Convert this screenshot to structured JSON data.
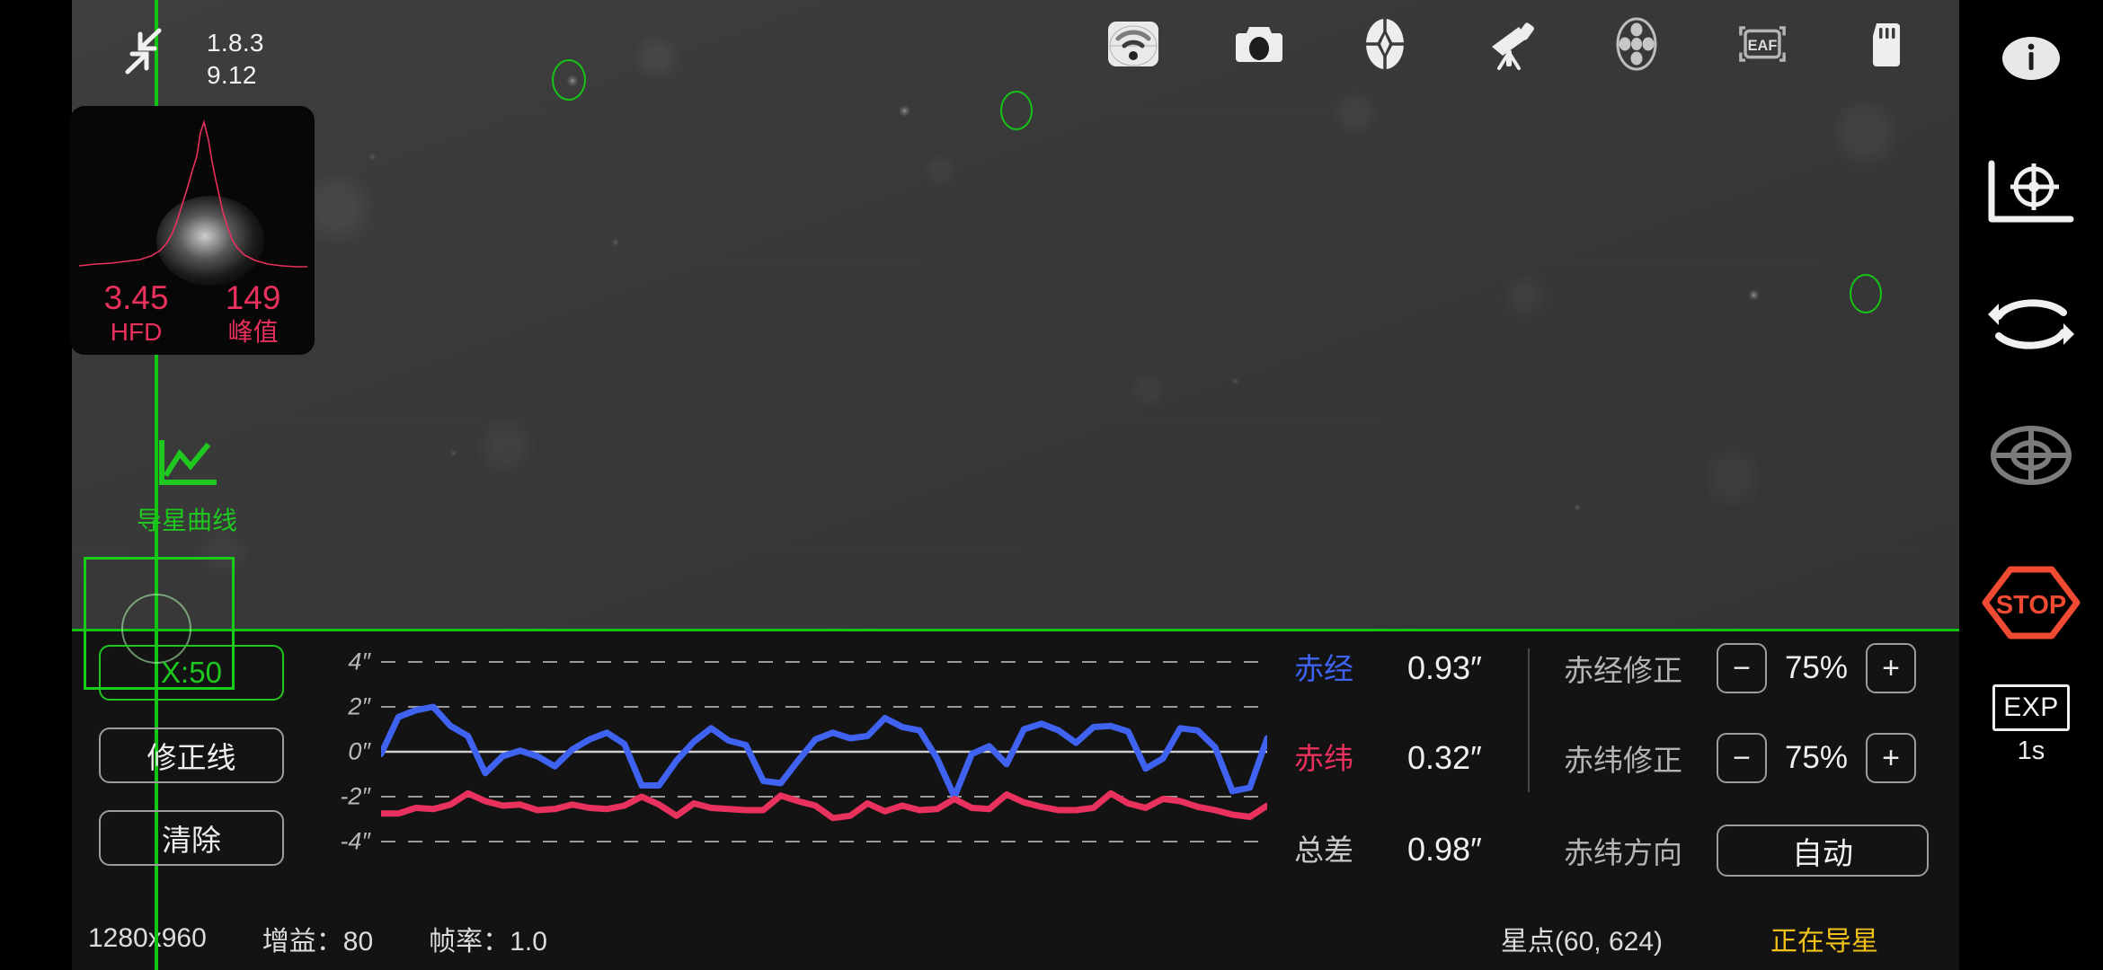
{
  "app": {
    "version": "1.8.3",
    "build": "9.12",
    "collapse_icon": "collapse-arrows-icon"
  },
  "focus_panel": {
    "hfd_value": "3.45",
    "hfd_label": "HFD",
    "peak_value": "149",
    "peak_label": "峰值"
  },
  "guide_tab": {
    "label": "导星曲线",
    "icon": "line-chart-icon"
  },
  "left_buttons": {
    "x_scale": "X:50",
    "correction_line": "修正线",
    "clear": "清除"
  },
  "toolbar": {
    "items": [
      {
        "name": "wifi-icon",
        "label": "WiFi"
      },
      {
        "name": "camera-icon",
        "label": "Camera"
      },
      {
        "name": "guider-icon",
        "label": "Guider"
      },
      {
        "name": "telescope-icon",
        "label": "Telescope"
      },
      {
        "name": "filterwheel-icon",
        "label": "Filter Wheel"
      },
      {
        "name": "eaf-icon",
        "label": "EAF"
      },
      {
        "name": "sdcard-icon",
        "label": "SD Card"
      }
    ]
  },
  "right_rail": {
    "items": [
      {
        "name": "info-icon",
        "label": "Info"
      },
      {
        "name": "calibration-icon",
        "label": "Calibration"
      },
      {
        "name": "loop-icon",
        "label": "Loop"
      },
      {
        "name": "target-icon",
        "label": "Target"
      },
      {
        "name": "stop-icon",
        "label": "STOP"
      }
    ],
    "exposure": {
      "label": "EXP",
      "value": "1s"
    }
  },
  "stats": {
    "ra": {
      "label": "赤经",
      "value": "0.93″"
    },
    "dec": {
      "label": "赤纬",
      "value": "0.32″"
    },
    "total": {
      "label": "总差",
      "value": "0.98″"
    }
  },
  "controls": {
    "ra_correction": {
      "label": "赤经修正",
      "minus": "−",
      "value": "75%",
      "plus": "+"
    },
    "dec_correction": {
      "label": "赤纬修正",
      "minus": "−",
      "value": "75%",
      "plus": "+"
    },
    "dec_direction": {
      "label": "赤纬方向",
      "value": "自动"
    }
  },
  "status_bar": {
    "resolution": "1280x960",
    "gain": "增益：80",
    "frame_rate": "帧率：1.0",
    "star_point": "星点(60, 624)",
    "state": "正在导星"
  },
  "colors": {
    "ra_trace": "#3f63f0",
    "dec_trace": "#e8315c",
    "overlay_green": "#12c512",
    "stop_red": "#f04a32",
    "status_warn": "#f2c21a",
    "hfd_pink": "#e8315c"
  },
  "chart_data": {
    "type": "line",
    "title": "",
    "xlabel": "",
    "ylabel": "",
    "ylim": [
      -5,
      5
    ],
    "yticks": [
      4,
      2,
      0,
      -2,
      -4
    ],
    "ytick_labels": [
      "4″",
      "2″",
      "0″",
      "-2″",
      "-4″"
    ],
    "grid": true,
    "zero_line": true,
    "x_scale_points": 50,
    "legend": [
      "赤经",
      "赤纬"
    ],
    "series": [
      {
        "name": "赤经",
        "color": "#3f63f0",
        "values": [
          -0.1,
          1.55,
          1.85,
          2.0,
          1.15,
          0.7,
          -0.95,
          -0.2,
          0.05,
          -0.2,
          -0.65,
          0.1,
          0.55,
          0.85,
          0.35,
          -1.5,
          -1.5,
          -0.4,
          0.45,
          1.05,
          0.5,
          0.3,
          -1.3,
          -1.4,
          -0.4,
          0.55,
          0.85,
          0.6,
          0.7,
          1.5,
          1.1,
          0.95,
          -0.3,
          -2.0,
          -0.1,
          0.25,
          -0.55,
          1.0,
          1.25,
          0.95,
          0.4,
          1.1,
          1.15,
          0.9,
          -0.75,
          -0.3,
          1.05,
          0.95,
          0.2,
          -1.75,
          -1.6,
          0.6
        ]
      },
      {
        "name": "赤纬",
        "color": "#e8315c",
        "values": [
          -2.75,
          -2.75,
          -2.5,
          -2.55,
          -2.35,
          -1.85,
          -2.2,
          -2.4,
          -2.35,
          -2.6,
          -2.55,
          -2.35,
          -2.5,
          -2.55,
          -2.4,
          -2.0,
          -2.35,
          -2.85,
          -2.3,
          -2.5,
          -2.55,
          -2.6,
          -2.6,
          -1.95,
          -2.2,
          -2.4,
          -2.95,
          -2.85,
          -2.3,
          -2.65,
          -2.4,
          -2.6,
          -2.55,
          -2.1,
          -2.5,
          -2.55,
          -1.9,
          -2.25,
          -2.45,
          -2.6,
          -2.6,
          -2.5,
          -1.85,
          -2.3,
          -2.5,
          -2.1,
          -2.2,
          -2.45,
          -2.6,
          -2.8,
          -2.9,
          -2.4
        ]
      }
    ]
  }
}
